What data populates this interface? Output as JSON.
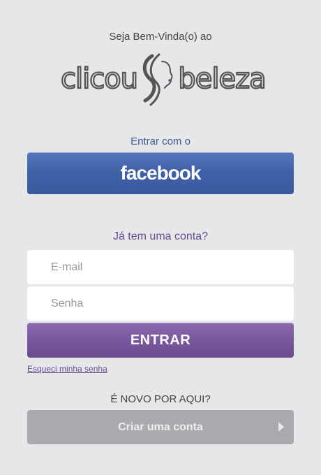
{
  "header": {
    "welcome_text": "Seja Bem-Vinda(o) ao",
    "logo_text_left": "clicou",
    "logo_text_right": "beleza"
  },
  "facebook": {
    "caption": "Entrar com o",
    "button_label": "facebook",
    "color": "#3f61a8"
  },
  "login": {
    "caption": "Já tem uma conta?",
    "email_placeholder": "E-mail",
    "password_placeholder": "Senha",
    "submit_label": "ENTRAR",
    "forgot_label": "Esqueci minha senha",
    "accent_color": "#7a579f"
  },
  "signup": {
    "caption": "É NOVO POR AQUI?",
    "button_label": "Criar uma conta",
    "arrow_icon": "play-right-icon"
  }
}
